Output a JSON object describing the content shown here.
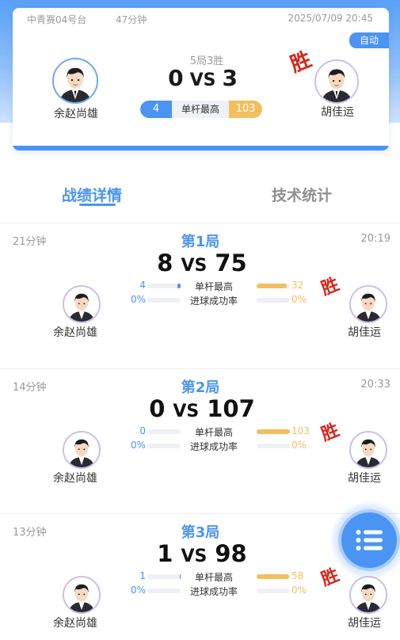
{
  "summary": {
    "table": "中青赛04号台",
    "duration": "47分钟",
    "datetime": "2025/07/09 20:45",
    "auto_badge": "自动",
    "format": "5局3胜",
    "score_left": "0",
    "vs": "VS",
    "score_right": "3",
    "win_mark": "胜",
    "highest_break_label": "单杆最高",
    "highest_break_left": "4",
    "highest_break_right": "103",
    "player_left": "余赵尚雄",
    "player_right": "胡佳运"
  },
  "tabs": [
    {
      "label": "战绩详情",
      "active": true
    },
    {
      "label": "技术统计",
      "active": false
    }
  ],
  "stat_labels": {
    "highest_break": "单杆最高",
    "pot_rate": "进球成功率"
  },
  "games": [
    {
      "duration": "21分钟",
      "time": "20:19",
      "title": "第1局",
      "score_left": "8",
      "score_right": "75",
      "break_left": "4",
      "break_right": "32",
      "break_left_fill": 0.1,
      "break_right_fill": 0.9,
      "rate_left": "0%",
      "rate_right": "0%",
      "player_left": "余赵尚雄",
      "player_right": "胡佳运",
      "win_mark": "胜"
    },
    {
      "duration": "14分钟",
      "time": "20:33",
      "title": "第2局",
      "score_left": "0",
      "score_right": "107",
      "break_left": "0",
      "break_right": "103",
      "break_left_fill": 0.0,
      "break_right_fill": 1.0,
      "rate_left": "0%",
      "rate_right": "0%",
      "player_left": "余赵尚雄",
      "player_right": "胡佳运",
      "win_mark": "胜"
    },
    {
      "duration": "13分钟",
      "time": "",
      "title": "第3局",
      "score_left": "1",
      "score_right": "98",
      "break_left": "1",
      "break_right": "58",
      "break_left_fill": 0.03,
      "break_right_fill": 0.97,
      "rate_left": "0%",
      "rate_right": "0%",
      "player_left": "余赵尚雄",
      "player_right": "胡佳运",
      "win_mark": "胜"
    }
  ],
  "colors": {
    "primary": "#4a94f4",
    "accent": "#f3be5e",
    "win": "#d7261c"
  },
  "icons": {
    "avatar": "player-avatar-icon",
    "fab": "menu-list-icon"
  }
}
